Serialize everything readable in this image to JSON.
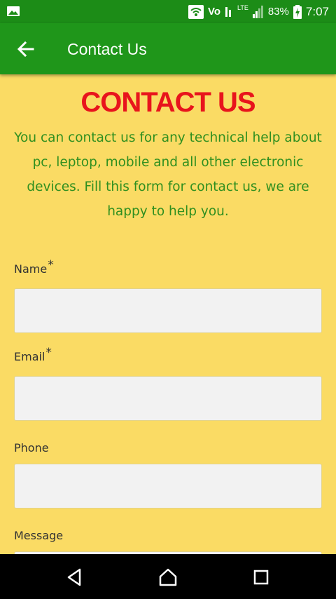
{
  "status_bar": {
    "network_label": "Vo",
    "lte_label": "LTE",
    "battery": "83%",
    "time": "7:07"
  },
  "toolbar": {
    "title": "Contact Us"
  },
  "content": {
    "heading": "CONTACT US",
    "intro": "You can contact us for any technical help about pc, leptop, mobile and all other electronic devices. Fill this form for contact us, we are happy to help you.",
    "form": {
      "name_label": "Name",
      "name_required": "*",
      "name_value": "",
      "email_label": "Email",
      "email_required": "*",
      "email_value": "",
      "phone_label": "Phone",
      "phone_value": "",
      "message_label": "Message"
    }
  },
  "colors": {
    "app_bar": "#1f961a",
    "status_bar": "#1c8c17",
    "background": "#fadb64",
    "heading": "#e8141c",
    "intro_text": "#2f8f1f"
  }
}
